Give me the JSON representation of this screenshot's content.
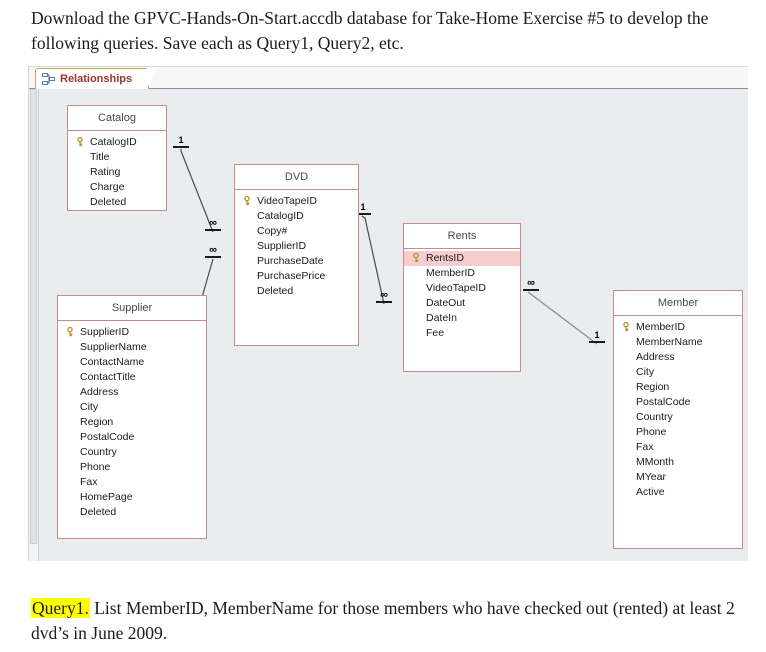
{
  "document": {
    "intro_paragraph": "Download the GPVC-Hands-On-Start.accdb database for Take-Home Exercise #5 to develop the following queries.  Save each as Query1, Query2, etc.",
    "query_label": "Query1.",
    "query_text": " List MemberID, MemberName for those members who have checked out (rented) at least 2 dvd’s in June 2009.",
    "highlight_color": "#ffff00"
  },
  "window": {
    "tab": {
      "label": "Relationships",
      "icon": "relationships-icon",
      "label_color": "#a0352c"
    },
    "canvas_background": "#e9edef",
    "table_border_color": "#c98a8a",
    "pk_highlight_color": "#f7cccc"
  },
  "tables": [
    {
      "name": "Catalog",
      "fields": [
        {
          "name": "CatalogID",
          "key": true
        },
        {
          "name": "Title",
          "key": false
        },
        {
          "name": "Rating",
          "key": false
        },
        {
          "name": "Charge",
          "key": false
        },
        {
          "name": "Deleted",
          "key": false
        }
      ]
    },
    {
      "name": "DVD",
      "fields": [
        {
          "name": "VideoTapeID",
          "key": true
        },
        {
          "name": "CatalogID",
          "key": false
        },
        {
          "name": "Copy#",
          "key": false
        },
        {
          "name": "SupplierID",
          "key": false
        },
        {
          "name": "PurchaseDate",
          "key": false
        },
        {
          "name": "PurchasePrice",
          "key": false
        },
        {
          "name": "Deleted",
          "key": false
        }
      ]
    },
    {
      "name": "Rents",
      "fields": [
        {
          "name": "RentsID",
          "key": true,
          "selected": true
        },
        {
          "name": "MemberID",
          "key": false
        },
        {
          "name": "VideoTapeID",
          "key": false
        },
        {
          "name": "DateOut",
          "key": false
        },
        {
          "name": "DateIn",
          "key": false
        },
        {
          "name": "Fee",
          "key": false
        }
      ]
    },
    {
      "name": "Supplier",
      "fields": [
        {
          "name": "SupplierID",
          "key": true
        },
        {
          "name": "SupplierName",
          "key": false
        },
        {
          "name": "ContactName",
          "key": false
        },
        {
          "name": "ContactTitle",
          "key": false
        },
        {
          "name": "Address",
          "key": false
        },
        {
          "name": "City",
          "key": false
        },
        {
          "name": "Region",
          "key": false
        },
        {
          "name": "PostalCode",
          "key": false
        },
        {
          "name": "Country",
          "key": false
        },
        {
          "name": "Phone",
          "key": false
        },
        {
          "name": "Fax",
          "key": false
        },
        {
          "name": "HomePage",
          "key": false
        },
        {
          "name": "Deleted",
          "key": false
        }
      ]
    },
    {
      "name": "Member",
      "fields": [
        {
          "name": "MemberID",
          "key": true
        },
        {
          "name": "MemberName",
          "key": false
        },
        {
          "name": "Address",
          "key": false
        },
        {
          "name": "City",
          "key": false
        },
        {
          "name": "Region",
          "key": false
        },
        {
          "name": "PostalCode",
          "key": false
        },
        {
          "name": "Country",
          "key": false
        },
        {
          "name": "Phone",
          "key": false
        },
        {
          "name": "Fax",
          "key": false
        },
        {
          "name": "MMonth",
          "key": false
        },
        {
          "name": "MYear",
          "key": false
        },
        {
          "name": "Active",
          "key": false
        }
      ]
    }
  ],
  "relationships": [
    {
      "from": "Catalog",
      "to": "DVD",
      "from_cardinality": "1",
      "to_cardinality": "∞"
    },
    {
      "from": "Supplier",
      "to": "DVD",
      "from_cardinality": "1",
      "to_cardinality": "∞"
    },
    {
      "from": "DVD",
      "to": "Rents",
      "from_cardinality": "1",
      "to_cardinality": "∞"
    },
    {
      "from": "Member",
      "to": "Rents",
      "from_cardinality": "1",
      "to_cardinality": "∞"
    }
  ]
}
